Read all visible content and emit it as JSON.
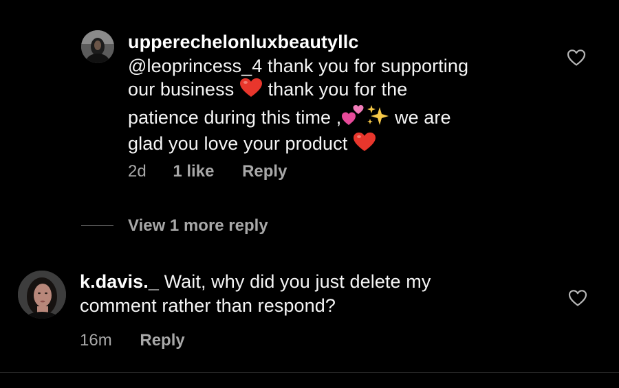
{
  "comments": [
    {
      "username": "upperechelonluxbeautyllc",
      "text_1": "@leoprincess_4 thank you for supporting",
      "text_2a": "our business ",
      "text_2b": " thank you for the",
      "text_3a": "patience during this time ,",
      "text_3b": " we are",
      "text_4a": "glad you love your product ",
      "time": "2d",
      "likes": "1 like",
      "reply": "Reply",
      "view_more": "View 1 more reply"
    },
    {
      "username": "k.davis._",
      "text_1": " Wait, why did you just delete my",
      "text_2": "comment rather than respond?",
      "time": "16m",
      "reply": "Reply"
    }
  ],
  "icons": {
    "like": "heart-outline-icon",
    "heart_emoji": "red-heart-emoji",
    "two_hearts_emoji": "two-hearts-emoji",
    "sparkles_emoji": "sparkles-emoji"
  },
  "colors": {
    "background": "#000000",
    "text": "#f5f5f5",
    "secondary": "#a8a8a8",
    "heart_emoji": "#e8362c",
    "pink_emoji": "#e84a9a",
    "sparkle_emoji": "#f7c948"
  }
}
